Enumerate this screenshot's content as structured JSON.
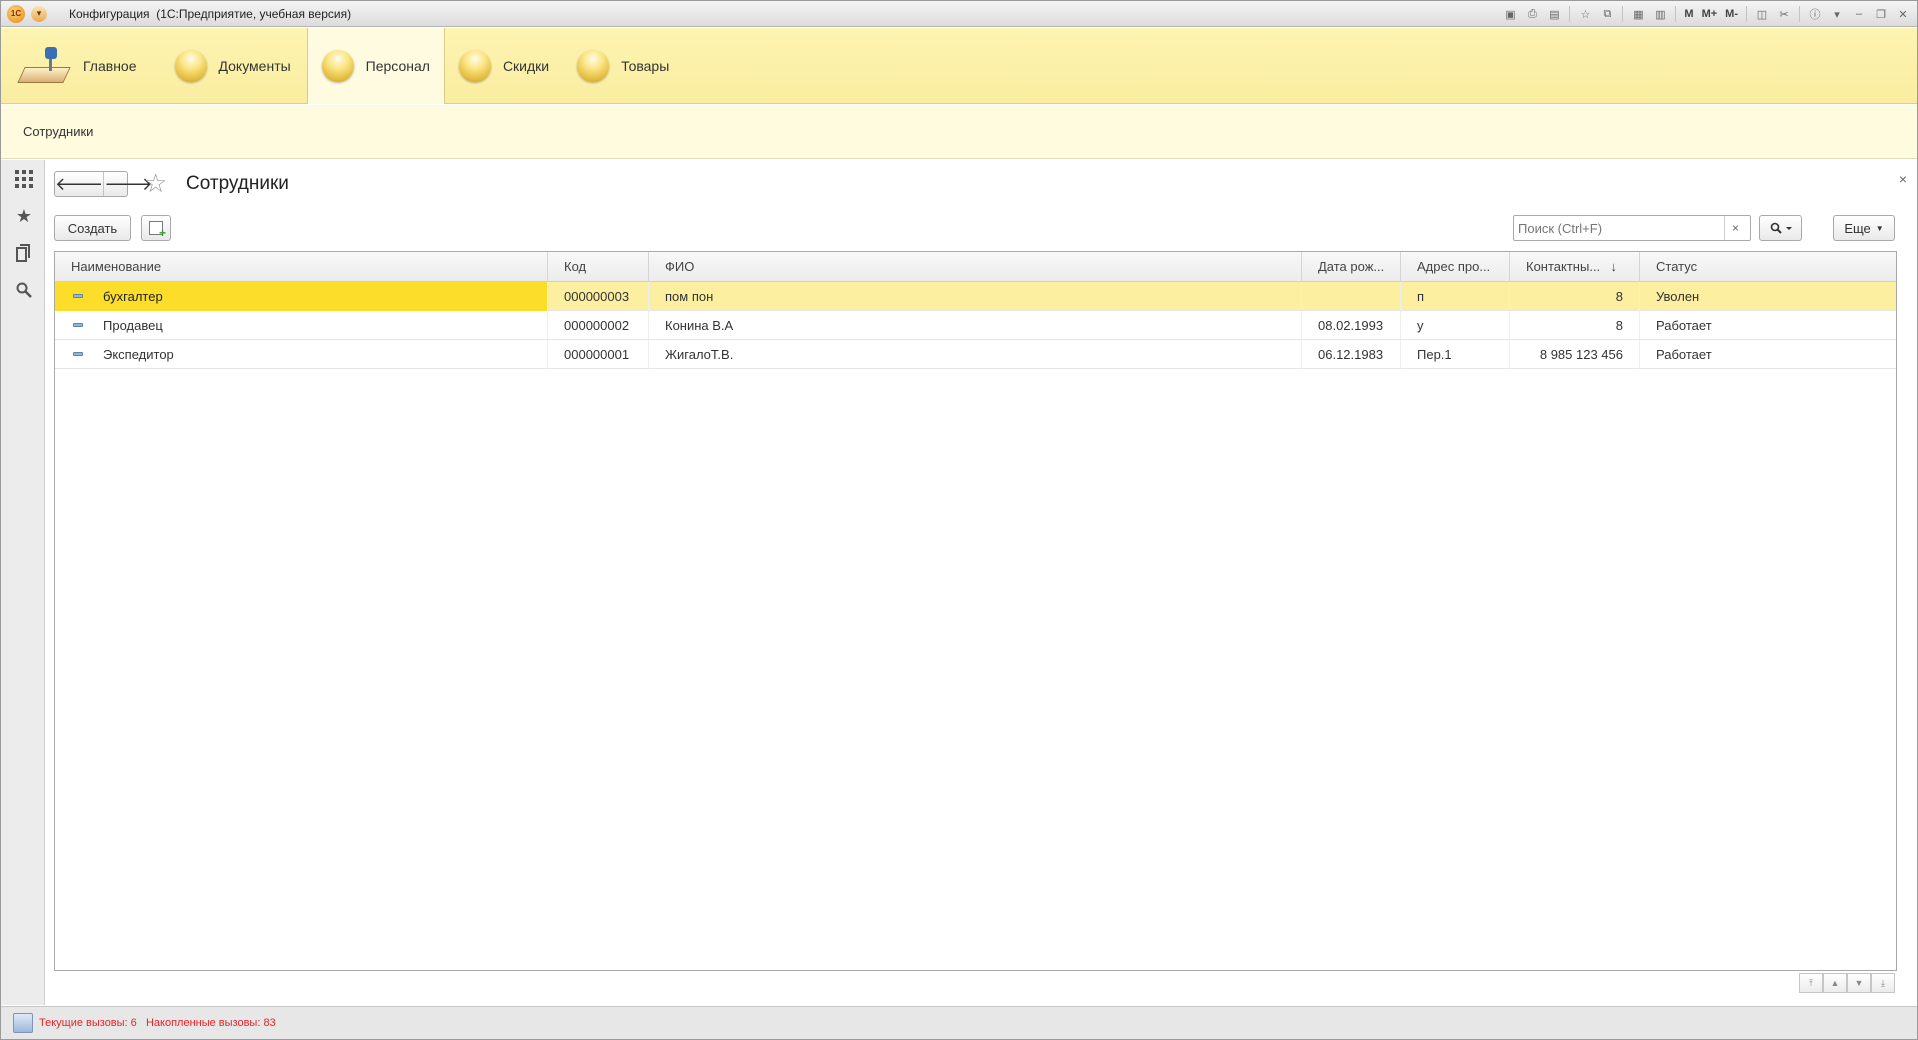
{
  "window": {
    "title": "Конфигурация  (1С:Предприятие, учебная версия)",
    "tools": {
      "m": "M",
      "mplus": "M+",
      "mminus": "M-"
    }
  },
  "sections": [
    {
      "label": "Главное",
      "icon": "desk-lamp-icon"
    },
    {
      "label": "Документы",
      "icon": "section-ball-icon"
    },
    {
      "label": "Персонал",
      "icon": "section-ball-icon",
      "active": true
    },
    {
      "label": "Скидки",
      "icon": "section-ball-icon"
    },
    {
      "label": "Товары",
      "icon": "section-ball-icon"
    }
  ],
  "subsection": {
    "link": "Сотрудники"
  },
  "form": {
    "title": "Сотрудники",
    "create_label": "Создать",
    "search_placeholder": "Поиск (Ctrl+F)",
    "clear_glyph": "×",
    "more_label": "Еще",
    "close_glyph": "×"
  },
  "table": {
    "columns": [
      "Наименование",
      "Код",
      "ФИО",
      "Дата рож...",
      "Адрес про...",
      "Контактны...",
      "Статус"
    ],
    "sort_indicator": "↓",
    "rows": [
      {
        "name": "бухгалтер",
        "code": "000000003",
        "fio": "пом пон",
        "birth": "",
        "address": "п",
        "contact": "8",
        "status": "Уволен",
        "selected": true
      },
      {
        "name": "Продавец",
        "code": "000000002",
        "fio": "Конина В.А",
        "birth": "08.02.1993",
        "address": "у",
        "contact": "8",
        "status": "Работает"
      },
      {
        "name": "Экспедитор",
        "code": "000000001",
        "fio": "ЖигалоТ.В.",
        "birth": "06.12.1983",
        "address": "Пер.1",
        "contact": "8 985 123 456",
        "status": "Работает"
      }
    ]
  },
  "statusbar": {
    "text": "Текущие вызовы: 6   Накопленные вызовы: 83",
    "color": "#e0272b"
  },
  "colors": {
    "sections_bg": "#faeda0",
    "selected_cell": "#fcdd2a",
    "selected_row": "#fcefa0"
  }
}
